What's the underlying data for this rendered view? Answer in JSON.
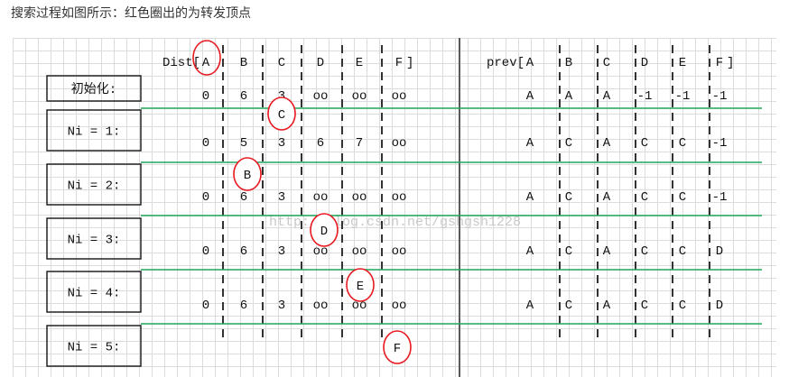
{
  "heading": "搜索过程如图所示：红色圈出的为转发顶点",
  "watermark": "http://blog.csdn.net/gshgsh1228",
  "dist_header": {
    "open": "Dist[",
    "close": "]"
  },
  "prev_header": {
    "open": "prev[",
    "close": "]"
  },
  "vertices": [
    "A",
    "B",
    "C",
    "D",
    "E",
    "F"
  ],
  "step_labels": [
    "初始化:",
    "Ni = 1:",
    "Ni = 2:",
    "Ni = 3:",
    "Ni = 4:",
    "Ni = 5:"
  ],
  "dist_rows": [
    [
      "0",
      "6",
      "3",
      "oo",
      "oo",
      "oo"
    ],
    [
      "0",
      "5",
      "3",
      "6",
      "7",
      "oo"
    ],
    [
      "0",
      "6",
      "3",
      "oo",
      "oo",
      "oo"
    ],
    [
      "0",
      "6",
      "3",
      "oo",
      "oo",
      "oo"
    ],
    [
      "0",
      "6",
      "3",
      "oo",
      "oo",
      "oo"
    ]
  ],
  "prev_rows": [
    [
      "A",
      "A",
      "A",
      "-1",
      "-1",
      "-1"
    ],
    [
      "A",
      "C",
      "A",
      "C",
      "C",
      "-1"
    ],
    [
      "A",
      "C",
      "A",
      "C",
      "C",
      "-1"
    ],
    [
      "A",
      "C",
      "A",
      "C",
      "C",
      "D"
    ],
    [
      "A",
      "C",
      "A",
      "C",
      "C",
      "D"
    ]
  ],
  "circled": [
    "C",
    "B",
    "D",
    "E",
    "F"
  ],
  "colors": {
    "circle": "#e8181e",
    "separator": "#1ea65a",
    "ink": "#111111"
  }
}
